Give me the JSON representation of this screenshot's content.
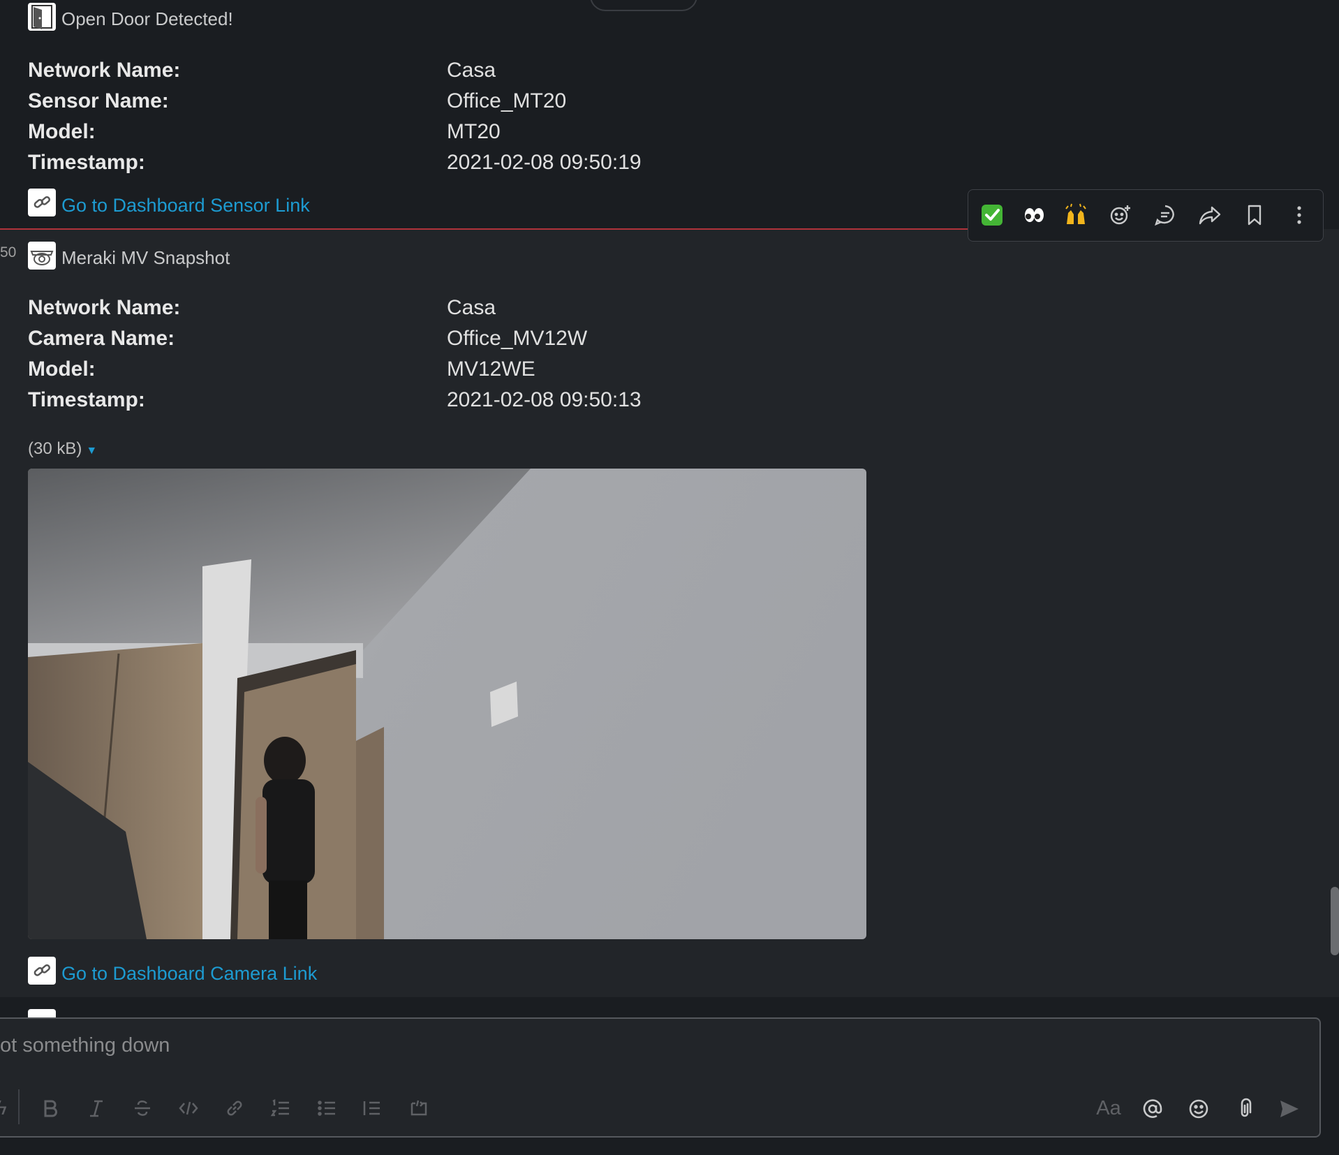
{
  "message_sensor": {
    "title": "Open Door Detected!",
    "fields": [
      {
        "label": "Network Name:",
        "value": "Casa"
      },
      {
        "label": "Sensor Name:",
        "value": "Office_MT20"
      },
      {
        "label": "Model:",
        "value": "MT20"
      },
      {
        "label": "Timestamp:",
        "value": "2021-02-08 09:50:19"
      }
    ],
    "link": "Go to Dashboard Sensor Link"
  },
  "message_camera": {
    "time_fragment": "50",
    "title": "Meraki MV Snapshot",
    "fields": [
      {
        "label": "Network Name:",
        "value": "Casa"
      },
      {
        "label": "Camera Name:",
        "value": "Office_MV12W"
      },
      {
        "label": "Model:",
        "value": "MV12WE"
      },
      {
        "label": "Timestamp:",
        "value": "2021-02-08 09:50:13"
      }
    ],
    "attachment_size": "(30 kB)",
    "link": "Go to Dashboard Camera Link"
  },
  "hover_toolbar": {
    "items": [
      {
        "icon": "white-check-mark-emoji",
        "glyph": "✅"
      },
      {
        "icon": "eyes-emoji",
        "glyph": "👀"
      },
      {
        "icon": "raised-hands-emoji",
        "glyph": "🙌"
      },
      {
        "icon": "add-reaction-icon"
      },
      {
        "icon": "reply-in-thread-icon"
      },
      {
        "icon": "share-icon"
      },
      {
        "icon": "save-bookmark-icon"
      },
      {
        "icon": "more-actions-icon"
      }
    ]
  },
  "composer": {
    "placeholder": "ot something down",
    "format_label": "Aa"
  },
  "colors": {
    "background": "#1a1d21",
    "message_hover": "#222529",
    "link": "#1d9bd1",
    "new_divider": "#b0333a"
  }
}
